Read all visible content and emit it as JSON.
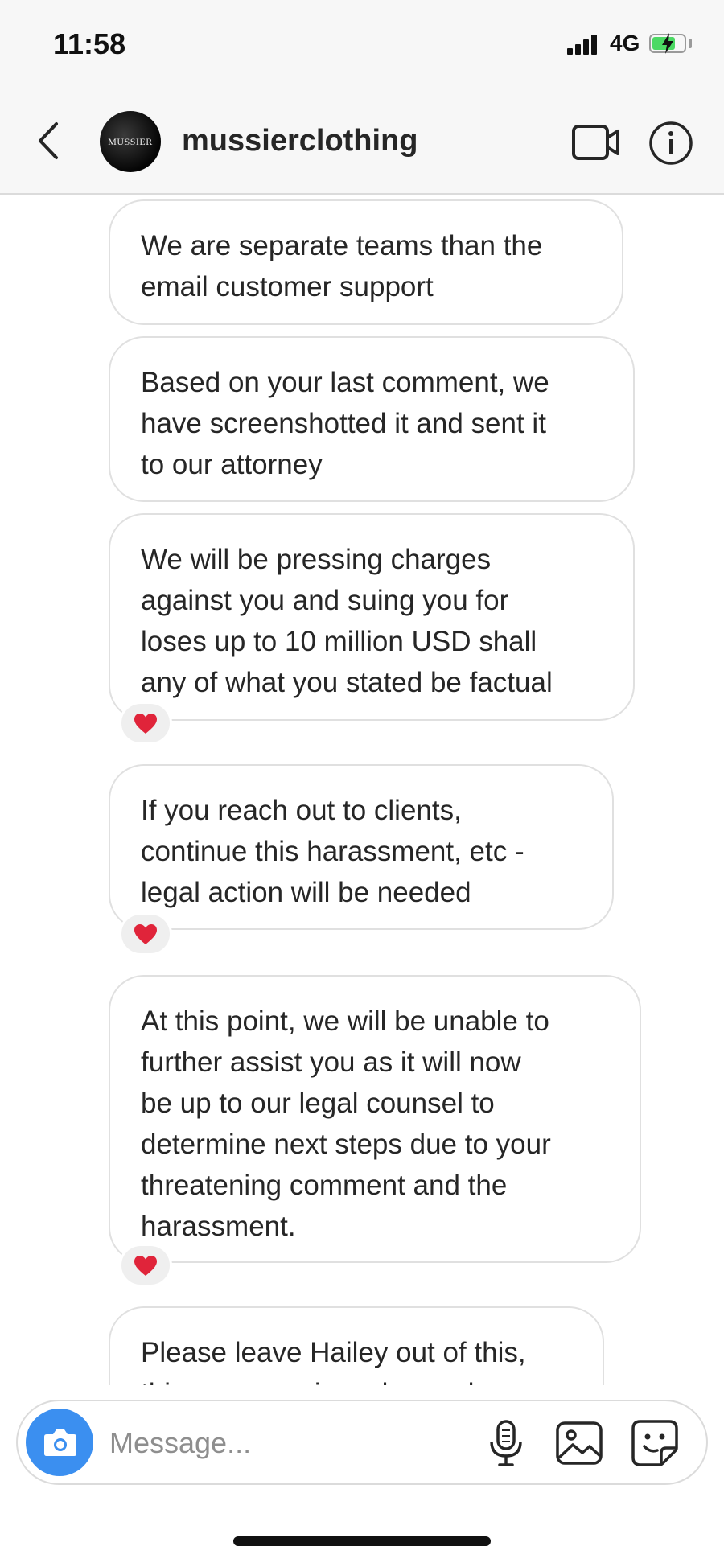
{
  "status_bar": {
    "time": "11:58",
    "network": "4G",
    "battery_charging": true
  },
  "header": {
    "username": "mussierclothing",
    "avatar_text": "MUSSIER",
    "icons": [
      "back-icon",
      "video-call-icon",
      "info-icon"
    ]
  },
  "messages": [
    {
      "text": "We are separate teams than the\nemail customer support",
      "reaction": ""
    },
    {
      "text": "Based on your last comment, we\nhave screenshotted it and sent it\nto our attorney",
      "reaction": ""
    },
    {
      "text": "We will be pressing charges\nagainst you and suing you for\nloses up to 10 million USD shall\nany of what you stated be factual",
      "reaction": "heart"
    },
    {
      "text": "If you reach out to clients,\ncontinue this harassment, etc -\nlegal action will be needed",
      "reaction": "heart"
    },
    {
      "text": "At this point, we will be unable to\nfurther assist you as it will now\nbe up to our legal counsel to\ndetermine next steps due to your\nthreatening comment and the\nharassment.",
      "reaction": "heart"
    },
    {
      "text": "Please leave Hailey out of this,\nthis company is no longer her",
      "reaction": ""
    }
  ],
  "composer": {
    "placeholder": "Message...",
    "icons": [
      "camera-icon",
      "microphone-icon",
      "gallery-icon",
      "sticker-icon"
    ]
  },
  "colors": {
    "accent": "#3b8ff0",
    "heart": "#e0243a",
    "bubble_border": "#e0e0e0"
  }
}
